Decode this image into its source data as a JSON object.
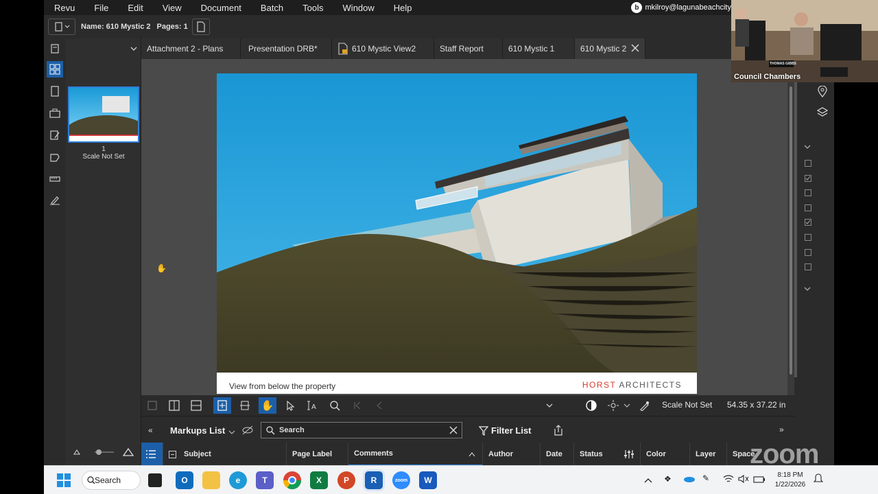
{
  "menu": {
    "items": [
      "Revu",
      "File",
      "Edit",
      "View",
      "Document",
      "Batch",
      "Tools",
      "Window",
      "Help"
    ],
    "account": "mkilroy@lagunabeachcity"
  },
  "docinfo": {
    "name": "Name: 610 Mystic 2",
    "pages": "Pages: 1"
  },
  "thumbnail": {
    "page_number": "1",
    "scale": "Scale Not Set"
  },
  "tabs": [
    {
      "label": "Attachment 2 - Plans"
    },
    {
      "label": "Presentation DRB*"
    },
    {
      "label": "610 Mystic View2"
    },
    {
      "label": "Staff Report"
    },
    {
      "label": "610 Mystic 1"
    },
    {
      "label": "610 Mystic 2"
    }
  ],
  "document": {
    "caption": "View from below the property",
    "firm_accent": "HORST",
    "firm_rest": " ARCHITECTS"
  },
  "bottombar": {
    "scale": "Scale Not Set",
    "dimensions": "54.35 x 37.22 in"
  },
  "markups": {
    "title": "Markups List",
    "search_placeholder": "Search",
    "filter_label": "Filter List",
    "columns": [
      "Subject",
      "Page Label",
      "Comments",
      "Author",
      "Date",
      "Status",
      "Color",
      "Layer",
      "Space"
    ]
  },
  "zoom": {
    "room_label": "Council Chambers",
    "nameplate": "THOMAS GIBBS",
    "watermark": "zoom"
  },
  "taskbar": {
    "search": "Search",
    "time": "8:18 PM",
    "date": "1/22/2026"
  },
  "colors": {
    "accent_blue": "#1c5fa8",
    "sky": "#1a9ad7",
    "hill": "#4a4630",
    "firm_red": "#d9392b"
  }
}
